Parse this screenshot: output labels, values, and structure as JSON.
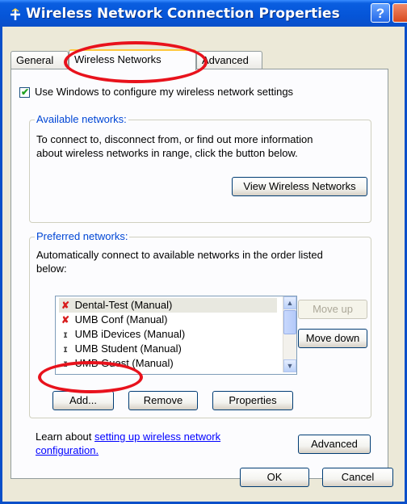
{
  "window": {
    "title": "Wireless Network Connection Properties",
    "help_label": "?"
  },
  "tabs": [
    {
      "label": "General",
      "active": false
    },
    {
      "label": "Wireless Networks",
      "active": true
    },
    {
      "label": "Advanced",
      "active": false
    }
  ],
  "use_windows": {
    "label": "Use Windows to configure my wireless network settings",
    "checked": true
  },
  "available_networks": {
    "title": "Available networks:",
    "description_line1": "To connect to, disconnect from, or find out more information",
    "description_line2": "about wireless networks in range, click the button below.",
    "view_button": "View Wireless Networks"
  },
  "preferred_networks": {
    "title": "Preferred networks:",
    "description_line1": "Automatically connect to available networks in the order listed",
    "description_line2": "below:",
    "networks": [
      {
        "name": "Dental-Test (Manual)",
        "icon": "wireless-disconnected-icon"
      },
      {
        "name": "UMB Conf (Manual)",
        "icon": "wireless-disconnected-icon"
      },
      {
        "name": "UMB iDevices (Manual)",
        "icon": "wireless-network-icon"
      },
      {
        "name": "UMB Student (Manual)",
        "icon": "wireless-network-icon"
      },
      {
        "name": "UMB Guest (Manual)",
        "icon": "wireless-network-icon"
      }
    ],
    "move_up": "Move up",
    "move_down": "Move down",
    "add": "Add...",
    "remove": "Remove",
    "properties": "Properties"
  },
  "learn": {
    "prefix": "Learn about ",
    "link_line1": "setting up wireless network",
    "link_line2": "configuration."
  },
  "advanced_button": "Advanced",
  "ok_button": "OK",
  "cancel_button": "Cancel",
  "colors": {
    "titlebar": "#0555d8",
    "dialog_bg": "#ece9d8",
    "group_title": "#0046d5",
    "highlight_ellipse": "#e8121c"
  }
}
